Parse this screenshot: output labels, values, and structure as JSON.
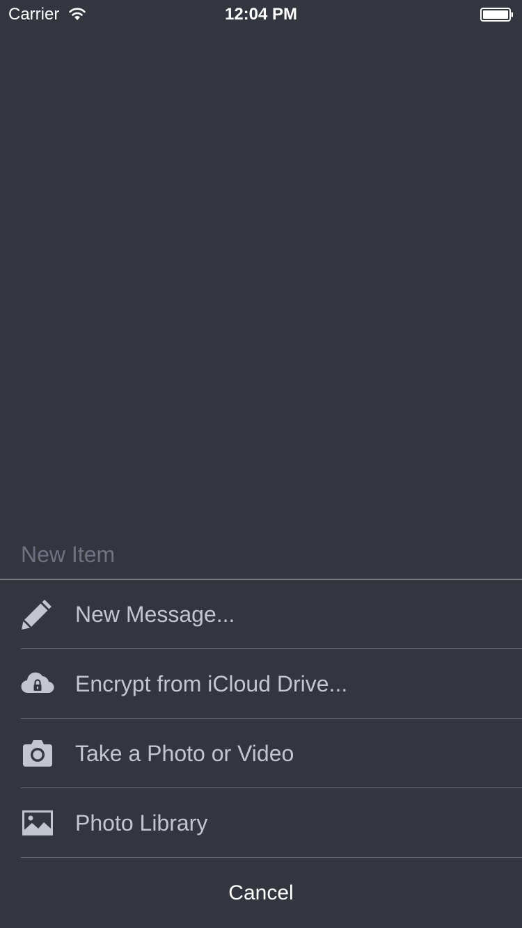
{
  "status_bar": {
    "carrier": "Carrier",
    "time": "12:04 PM",
    "wifi_icon": "wifi-icon",
    "battery_icon": "battery-icon"
  },
  "sheet": {
    "header": "New Item",
    "items": [
      {
        "label": "New Message...",
        "icon": "pencil-icon"
      },
      {
        "label": "Encrypt from iCloud Drive...",
        "icon": "cloud-lock-icon"
      },
      {
        "label": "Take a Photo or Video",
        "icon": "camera-icon"
      },
      {
        "label": "Photo Library",
        "icon": "photo-library-icon"
      }
    ],
    "cancel_label": "Cancel"
  },
  "colors": {
    "background": "#33353f",
    "header_text": "#6f7381",
    "item_text": "#c3c6cf",
    "icon": "#c3c6cf",
    "separator": "#6a6d78"
  }
}
